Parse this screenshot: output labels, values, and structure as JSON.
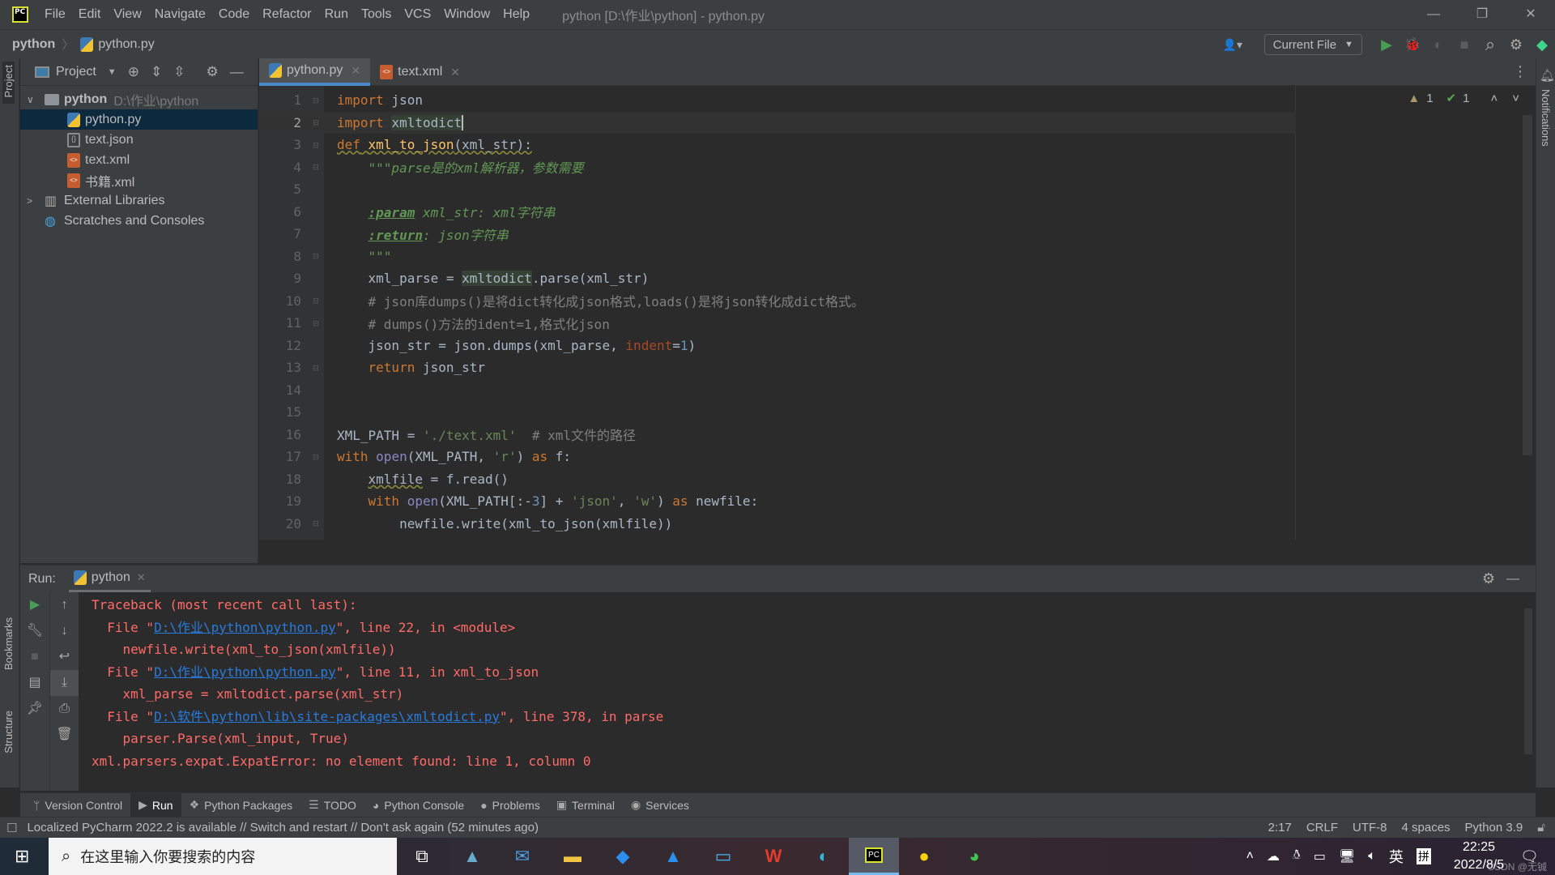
{
  "titlebar": {
    "app_logo": "PC",
    "menu": [
      "File",
      "Edit",
      "View",
      "Navigate",
      "Code",
      "Refactor",
      "Run",
      "Tools",
      "VCS",
      "Window",
      "Help"
    ],
    "title": "python [D:\\作业\\python] - python.py",
    "minimize": "—",
    "restore": "❐",
    "close": "✕"
  },
  "navbar": {
    "breadcrumb_root": "python",
    "breadcrumb_sep": "〉",
    "breadcrumb_file": "python.py",
    "run_config": "Current File",
    "icons": {
      "vcs": "👤▾",
      "run": "▶",
      "debug": "🐞",
      "coverage": "◐",
      "stop": "■",
      "search": "⌕",
      "settings": "⚙",
      "toolbox": "◆"
    }
  },
  "left_strip": {
    "project": "Project",
    "bookmarks": "Bookmarks",
    "structure": "Structure"
  },
  "project_panel": {
    "title": "Project",
    "tree": [
      {
        "label": "python",
        "hint": "D:\\作业\\python",
        "type": "folder",
        "expanded": true,
        "indent": 0
      },
      {
        "label": "python.py",
        "type": "py",
        "indent": 1,
        "selected": true
      },
      {
        "label": "text.json",
        "type": "json",
        "indent": 1
      },
      {
        "label": "text.xml",
        "type": "xml",
        "indent": 1
      },
      {
        "label": "书籍.xml",
        "type": "xml",
        "indent": 1
      },
      {
        "label": "External Libraries",
        "type": "lib",
        "indent": 0,
        "collapsed": true
      },
      {
        "label": "Scratches and Consoles",
        "type": "scratch",
        "indent": 0
      }
    ]
  },
  "tabs": [
    {
      "label": "python.py",
      "type": "py",
      "active": true
    },
    {
      "label": "text.xml",
      "type": "xml",
      "active": false
    }
  ],
  "editor": {
    "inspections": {
      "warnings": "1",
      "typos": "1"
    },
    "current_line": 2,
    "lines": [
      {
        "n": "1"
      },
      {
        "n": "2"
      },
      {
        "n": "3"
      },
      {
        "n": "4"
      },
      {
        "n": "5"
      },
      {
        "n": "6"
      },
      {
        "n": "7"
      },
      {
        "n": "8"
      },
      {
        "n": "9"
      },
      {
        "n": "10"
      },
      {
        "n": "11"
      },
      {
        "n": "12"
      },
      {
        "n": "13"
      },
      {
        "n": "14"
      },
      {
        "n": "15"
      },
      {
        "n": "16"
      },
      {
        "n": "17"
      },
      {
        "n": "18"
      },
      {
        "n": "19"
      },
      {
        "n": "20"
      }
    ],
    "code": {
      "l1": [
        "import",
        " json"
      ],
      "l2": [
        "import",
        " ",
        "xmltodict"
      ],
      "l3": [
        "def",
        " ",
        "xml_to_json",
        "(xml_str):"
      ],
      "l4": [
        "    ",
        "\"\"\"parse是的xml解析器，参数需要"
      ],
      "l6": [
        "    ",
        ":param",
        " xml_str: xml字符串"
      ],
      "l7": [
        "    ",
        ":return",
        ": json字符串"
      ],
      "l8": [
        "    ",
        "\"\"\""
      ],
      "l9": [
        "    xml_parse = ",
        "xmltodict",
        ".parse(xml_str)"
      ],
      "l10": [
        "    # json库dumps()是将dict转化成json格式,loads()是将json转化成dict格式。"
      ],
      "l11": [
        "    # dumps()方法的ident=1,格式化json"
      ],
      "l12": [
        "    json_str = json.dumps(xml_parse, ",
        "indent",
        "=",
        "1",
        ")"
      ],
      "l13": [
        "    ",
        "return",
        " json_str"
      ],
      "l16": [
        "XML_PATH = ",
        "'./text.xml'",
        "  # xml文件的路径"
      ],
      "l17": [
        "with",
        " ",
        "open",
        "(XML_PATH, ",
        "'r'",
        ") ",
        "as",
        " f:"
      ],
      "l18": [
        "    ",
        "xmlfile",
        " = f.read()"
      ],
      "l19": [
        "    ",
        "with",
        " ",
        "open",
        "(XML_PATH[:-",
        "3",
        "] + ",
        "'json'",
        ", ",
        "'w'",
        ") ",
        "as",
        " newfile:"
      ],
      "l20": [
        "        newfile.write(xml_to_json(xmlfile))"
      ]
    }
  },
  "run_panel": {
    "label": "Run:",
    "tab": "python",
    "console": {
      "l1": "Traceback (most recent call last):",
      "l2_pre": "  File \"",
      "l2_link": "D:\\作业\\python\\python.py",
      "l2_post": "\", line 22, in <module>",
      "l3": "    newfile.write(xml_to_json(xmlfile))",
      "l4_pre": "  File \"",
      "l4_link": "D:\\作业\\python\\python.py",
      "l4_post": "\", line 11, in xml_to_json",
      "l5": "    xml_parse = xmltodict.parse(xml_str)",
      "l6_pre": "  File \"",
      "l6_link": "D:\\软件\\python\\lib\\site-packages\\xmltodict.py",
      "l6_post": "\", line 378, in parse",
      "l7": "    parser.Parse(xml_input, True)",
      "l8": "xml.parsers.expat.ExpatError: no element found: line 1, column 0"
    }
  },
  "tool_windows": [
    {
      "label": "Version Control",
      "icon": "ᛘ"
    },
    {
      "label": "Run",
      "icon": "▶",
      "active": true
    },
    {
      "label": "Python Packages",
      "icon": "❖"
    },
    {
      "label": "TODO",
      "icon": "☰"
    },
    {
      "label": "Python Console",
      "icon": "◕"
    },
    {
      "label": "Problems",
      "icon": "●"
    },
    {
      "label": "Terminal",
      "icon": "▣"
    },
    {
      "label": "Services",
      "icon": "◉"
    }
  ],
  "right_strip": {
    "notifications": "Notifications"
  },
  "statusbar": {
    "message": "Localized PyCharm 2022.2 is available // Switch and restart // Don't ask again (52 minutes ago)",
    "position": "2:17",
    "line_sep": "CRLF",
    "encoding": "UTF-8",
    "indent": "4 spaces",
    "interpreter": "Python 3.9"
  },
  "taskbar": {
    "search_placeholder": "在这里输入你要搜索的内容",
    "ime_lang": "英",
    "ime_mode": "拼",
    "time": "22:25",
    "date": "2022/8/5",
    "watermark": "CSDN @无铖"
  }
}
